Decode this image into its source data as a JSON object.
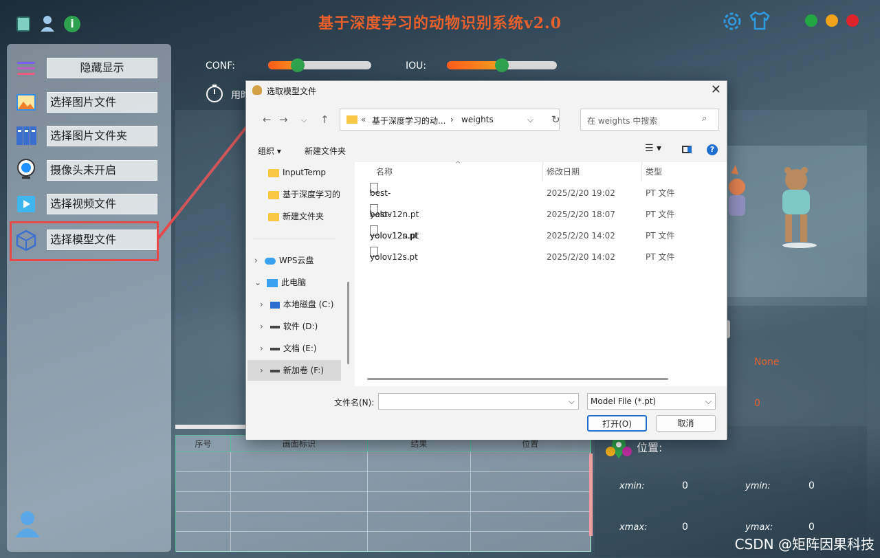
{
  "app": {
    "title": "基于深度学习的动物识别系统v2.0"
  },
  "sidebar": {
    "items": [
      {
        "label": "隐藏显示",
        "icon": "menu-lines-icon"
      },
      {
        "label": "选择图片文件",
        "icon": "image-icon"
      },
      {
        "label": "选择图片文件夹",
        "icon": "image-folder-icon"
      },
      {
        "label": "摄像头未开启",
        "icon": "camera-icon"
      },
      {
        "label": "选择视频文件",
        "icon": "video-icon"
      },
      {
        "label": "选择模型文件",
        "icon": "model-cube-icon"
      }
    ]
  },
  "controls": {
    "conf_label": "CONF:",
    "conf_value": 0.25,
    "iou_label": "IOU:",
    "iou_value": 0.5,
    "time_label": "用时"
  },
  "results_table": {
    "columns": [
      "序号",
      "画面标识",
      "结果",
      "位置"
    ],
    "rows": 5
  },
  "right_panel": {
    "class_value": "None",
    "count_value": "0",
    "position_label": "位置:",
    "xmin_label": "xmin:",
    "xmin_value": "0",
    "ymin_label": "ymin:",
    "ymin_value": "0",
    "xmax_label": "xmax:",
    "xmax_value": "0",
    "ymax_label": "ymax:",
    "ymax_value": "0"
  },
  "dialog": {
    "title": "选取模型文件",
    "breadcrumb_prefix": "«",
    "breadcrumb_parent": "基于深度学习的动...",
    "breadcrumb_sep": "›",
    "breadcrumb_current": "weights",
    "search_placeholder": "在 weights 中搜索",
    "organize_label": "组织",
    "new_folder_label": "新建文件夹",
    "nav_items": [
      {
        "label": "InputTemp",
        "type": "folder"
      },
      {
        "label": "基于深度学习的",
        "type": "folder"
      },
      {
        "label": "新建文件夹",
        "type": "folder"
      },
      {
        "label": "WPS云盘",
        "type": "cloud"
      },
      {
        "label": "此电脑",
        "type": "pc"
      },
      {
        "label": "本地磁盘 (C:)",
        "type": "drive"
      },
      {
        "label": "软件 (D:)",
        "type": "drive"
      },
      {
        "label": "文档 (E:)",
        "type": "drive"
      },
      {
        "label": "新加卷 (F:)",
        "type": "drive"
      }
    ],
    "columns": {
      "name": "名称",
      "modified": "修改日期",
      "type": "类型"
    },
    "files": [
      {
        "name": "best-yolov12n.pt",
        "modified": "2025/2/20 19:02",
        "type": "PT 文件"
      },
      {
        "name": "best-yolov12s.pt",
        "modified": "2025/2/20 18:07",
        "type": "PT 文件"
      },
      {
        "name": "yolov12n.pt",
        "modified": "2025/2/20 14:02",
        "type": "PT 文件"
      },
      {
        "name": "yolov12s.pt",
        "modified": "2025/2/20 14:02",
        "type": "PT 文件"
      }
    ],
    "filename_label": "文件名(N):",
    "filename_value": "",
    "filter_value": "Model File (*.pt)",
    "open_label": "打开(O)",
    "cancel_label": "取消"
  },
  "watermark": "CSDN @矩阵因果科技",
  "colors": {
    "accent_orange": "#e8602c",
    "highlight_red": "#e5494a",
    "slider_green": "#2fa24f"
  }
}
